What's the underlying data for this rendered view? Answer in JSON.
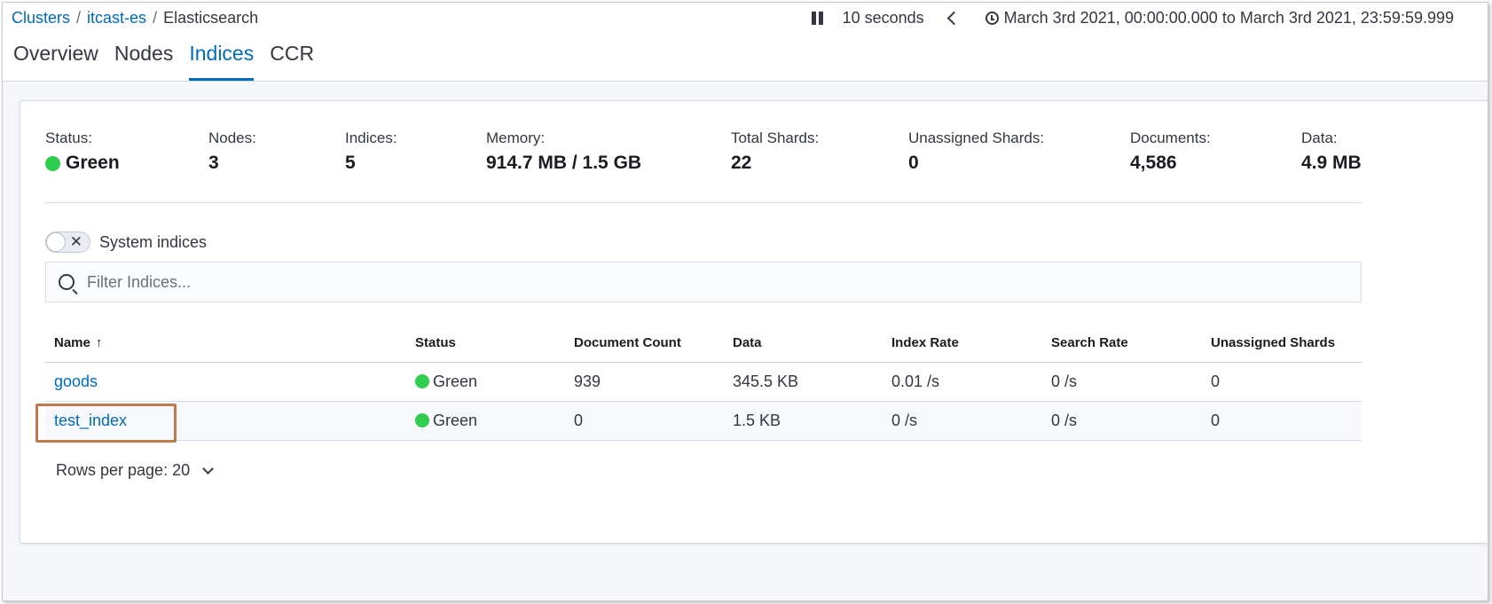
{
  "breadcrumb": {
    "items": [
      {
        "label": "Clusters"
      },
      {
        "label": "itcast-es"
      },
      {
        "label": "Elasticsearch"
      }
    ],
    "separator": "/"
  },
  "timebar": {
    "refresh_interval": "10 seconds",
    "time_range": "March 3rd 2021, 00:00:00.000 to March 3rd 2021, 23:59:59.999"
  },
  "tabs": [
    {
      "label": "Overview",
      "active": false
    },
    {
      "label": "Nodes",
      "active": false
    },
    {
      "label": "Indices",
      "active": true
    },
    {
      "label": "CCR",
      "active": false
    }
  ],
  "stats": {
    "status": {
      "label": "Status:",
      "value": "Green"
    },
    "nodes": {
      "label": "Nodes:",
      "value": "3"
    },
    "indices": {
      "label": "Indices:",
      "value": "5"
    },
    "memory": {
      "label": "Memory:",
      "value": "914.7 MB / 1.5 GB"
    },
    "total_shards": {
      "label": "Total Shards:",
      "value": "22"
    },
    "unassigned_shards": {
      "label": "Unassigned Shards:",
      "value": "0"
    },
    "documents": {
      "label": "Documents:",
      "value": "4,586"
    },
    "data": {
      "label": "Data:",
      "value": "4.9 MB"
    }
  },
  "system_indices": {
    "label": "System indices",
    "enabled": false
  },
  "filter": {
    "placeholder": "Filter Indices..."
  },
  "table": {
    "columns": [
      "Name",
      "Status",
      "Document Count",
      "Data",
      "Index Rate",
      "Search Rate",
      "Unassigned Shards"
    ],
    "sort_indicator": "↑",
    "rows": [
      {
        "name": "goods",
        "status": "Green",
        "document_count": "939",
        "data": "345.5 KB",
        "index_rate": "0.01 /s",
        "search_rate": "0 /s",
        "unassigned_shards": "0"
      },
      {
        "name": "test_index",
        "status": "Green",
        "document_count": "0",
        "data": "1.5 KB",
        "index_rate": "0 /s",
        "search_rate": "0 /s",
        "unassigned_shards": "0"
      }
    ]
  },
  "pagination": {
    "rows_per_page_label": "Rows per page: 20"
  },
  "colors": {
    "accent": "#006bb8",
    "status_green": "#2fcc4e",
    "highlight_box": "#c07a4f"
  }
}
